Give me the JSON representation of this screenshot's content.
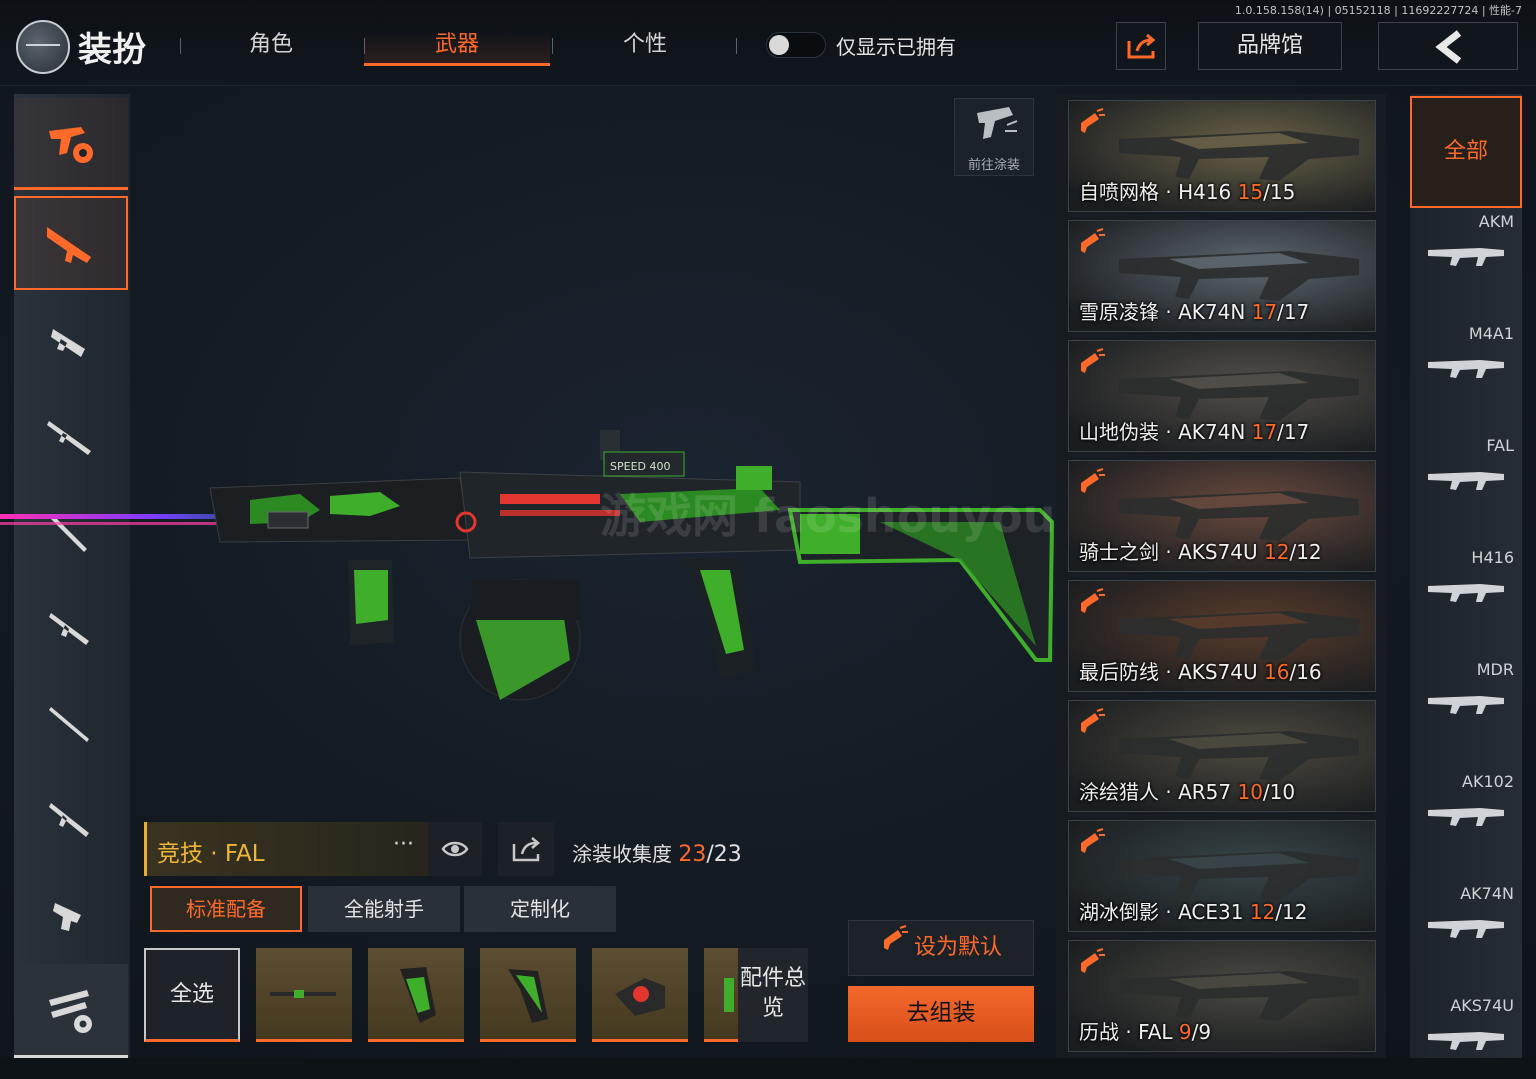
{
  "header": {
    "version": "1.0.158.158(14) | 05152118 | 11692227724 | 性能-7",
    "title": "装扮",
    "tabs": [
      {
        "label": "角色",
        "active": false
      },
      {
        "label": "武器",
        "active": true
      },
      {
        "label": "个性",
        "active": false
      }
    ],
    "owned_toggle_label": "仅显示已拥有",
    "owned_toggle_on": false,
    "brand_label": "品牌馆"
  },
  "left_categories": [
    {
      "icon": "paint-gun-icon",
      "selected": false
    },
    {
      "icon": "assault-rifle-icon",
      "selected": true
    },
    {
      "icon": "smg-icon",
      "selected": false
    },
    {
      "icon": "sniper-rifle-icon",
      "selected": false
    },
    {
      "icon": "marksman-rifle-icon",
      "selected": false
    },
    {
      "icon": "carbine-icon",
      "selected": false
    },
    {
      "icon": "shotgun-icon",
      "selected": false
    },
    {
      "icon": "lmg-icon",
      "selected": false
    },
    {
      "icon": "pistol-icon",
      "selected": false
    },
    {
      "icon": "melee-paint-icon",
      "selected": false
    }
  ],
  "showcase": {
    "go_paint_label": "前往涂装",
    "watermark": "游戏网 faoshouyou.com"
  },
  "selected_skin": {
    "name": "竞技 · FAL",
    "more": "···",
    "collection_label": "涂装收集度",
    "collection_current": "23",
    "collection_total": "/23"
  },
  "loadout_tabs": [
    {
      "label": "标准配备",
      "active": true
    },
    {
      "label": "全能射手",
      "active": false
    },
    {
      "label": "定制化",
      "active": false
    }
  ],
  "attachments": {
    "select_all_label": "全选",
    "items": [
      "barrel-attachment-icon",
      "grip-attachment-icon",
      "stock-attachment-icon",
      "sight-attachment-icon",
      "magazine-attachment-icon"
    ],
    "overview_label": "配件总览"
  },
  "actions": {
    "set_default_label": "设为默认",
    "assemble_label": "去组装"
  },
  "skins": [
    {
      "name": "自喷网格 · H416 ",
      "cur": "15",
      "tot": "/15",
      "color": "#6b6248"
    },
    {
      "name": "雪原凌锋 · AK74N ",
      "cur": "17",
      "tot": "/17",
      "color": "#5e6870"
    },
    {
      "name": "山地伪装 · AK74N ",
      "cur": "17",
      "tot": "/17",
      "color": "#54504a"
    },
    {
      "name": "骑士之剑 · AKS74U ",
      "cur": "12",
      "tot": "/12",
      "color": "#6a4a3e"
    },
    {
      "name": "最后防线 · AKS74U ",
      "cur": "16",
      "tot": "/16",
      "color": "#5a3c2c"
    },
    {
      "name": "涂绘猎人 · AR57 ",
      "cur": "10",
      "tot": "/10",
      "color": "#4e4a3e"
    },
    {
      "name": "湖冰倒影 · ACE31 ",
      "cur": "12",
      "tot": "/12",
      "color": "#38464a"
    },
    {
      "name": "历战 · FAL ",
      "cur": "9",
      "tot": "/9",
      "color": "#4a4a42"
    }
  ],
  "weapon_list": {
    "all_label": "全部",
    "items": [
      "AKM",
      "M4A1",
      "FAL",
      "H416",
      "MDR",
      "AK102",
      "AK74N",
      "AKS74U"
    ]
  },
  "colors": {
    "accent": "#ff6a2a",
    "gold": "#f0b63a",
    "gun_green": "#3fae2a"
  }
}
